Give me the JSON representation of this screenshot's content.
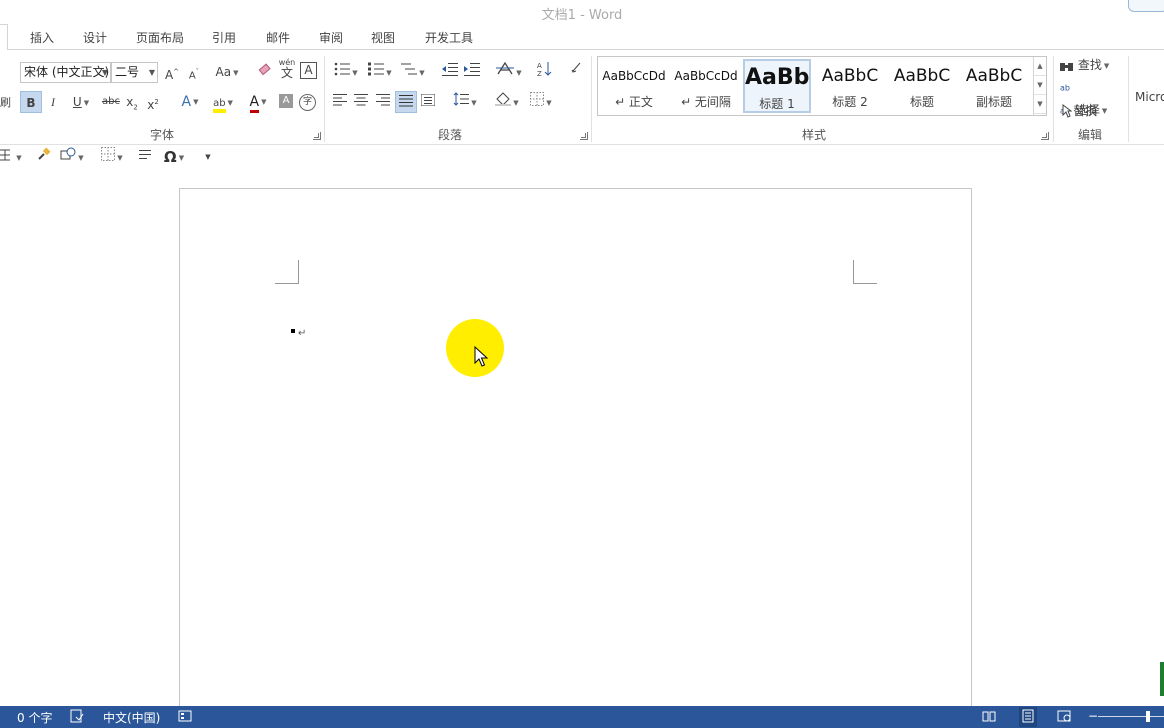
{
  "window": {
    "title": "文档1 - Word"
  },
  "tabs": [
    "插入",
    "设计",
    "页面布局",
    "引用",
    "邮件",
    "审阅",
    "视图",
    "开发工具"
  ],
  "font": {
    "name": "宋体 (中文正文)",
    "size": "二号",
    "group_label": "字体",
    "grow": "A",
    "shrink": "A",
    "case": "Aa",
    "phonetic": "wén",
    "phonetic_char": "文",
    "border_char": "A",
    "bold": "B",
    "italic": "I",
    "underline": "U",
    "strike": "abc",
    "subscript": "x",
    "superscript": "x",
    "text_effect": "A",
    "highlight": "ab",
    "font_color": "A",
    "shading": "A",
    "enclose": "字"
  },
  "paragraph": {
    "group_label": "段落"
  },
  "styles": {
    "group_label": "样式",
    "items": [
      {
        "sample": "AaBbCcDd",
        "name": "↵ 正文"
      },
      {
        "sample": "AaBbCcDd",
        "name": "↵ 无间隔"
      },
      {
        "sample": "AaBb",
        "name": "标题 1"
      },
      {
        "sample": "AaBbC",
        "name": "标题 2"
      },
      {
        "sample": "AaBbC",
        "name": "标题"
      },
      {
        "sample": "AaBbC",
        "name": "副标题"
      }
    ]
  },
  "editing": {
    "group_label": "编辑",
    "find": "查找",
    "replace": "替换",
    "select": "选择"
  },
  "right_cut": "Micro",
  "left_cut": "刷",
  "status": {
    "word_count": "0 个字",
    "language": "中文(中国)"
  },
  "colors": {
    "accent": "#2b579a",
    "highlight_yellow": "#ffee00",
    "font_red": "#c00000"
  }
}
